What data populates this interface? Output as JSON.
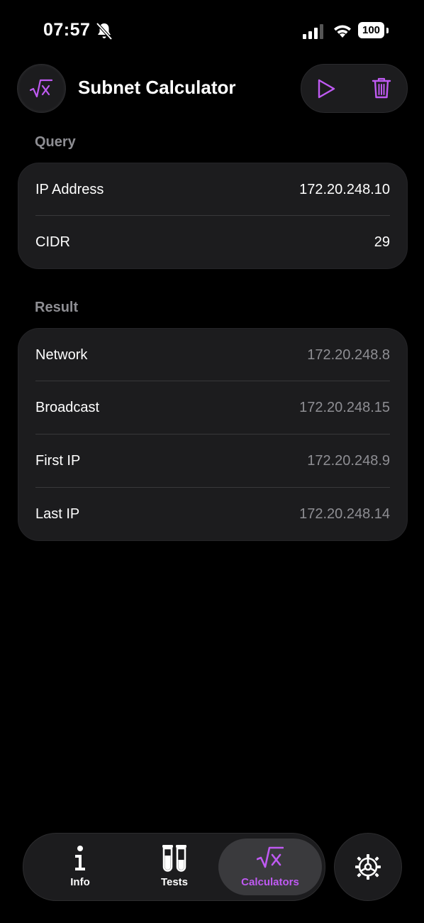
{
  "status_bar": {
    "time": "07:57",
    "battery": "100",
    "icons": [
      "bell-slash-icon",
      "signal-icon",
      "wifi-icon",
      "battery-icon"
    ]
  },
  "header": {
    "title": "Subnet Calculator",
    "left_icon": "square-root-x-icon",
    "actions": [
      "play-icon",
      "trash-icon"
    ]
  },
  "colors": {
    "accent": "#bf5af2",
    "card_bg": "#1c1c1e",
    "secondary_text": "#8e8e93"
  },
  "query": {
    "label": "Query",
    "rows": [
      {
        "key": "IP Address",
        "value": "172.20.248.10"
      },
      {
        "key": "CIDR",
        "value": "29"
      }
    ]
  },
  "result": {
    "label": "Result",
    "rows": [
      {
        "key": "Network",
        "value": "172.20.248.8"
      },
      {
        "key": "Broadcast",
        "value": "172.20.248.15"
      },
      {
        "key": "First IP",
        "value": "172.20.248.9"
      },
      {
        "key": "Last IP",
        "value": "172.20.248.14"
      }
    ]
  },
  "tabs": [
    {
      "label": "Info",
      "icon": "info-icon",
      "active": false
    },
    {
      "label": "Tests",
      "icon": "test-tubes-icon",
      "active": false
    },
    {
      "label": "Calculators",
      "icon": "square-root-x-icon",
      "active": true
    }
  ],
  "settings_icon": "gear-icon"
}
